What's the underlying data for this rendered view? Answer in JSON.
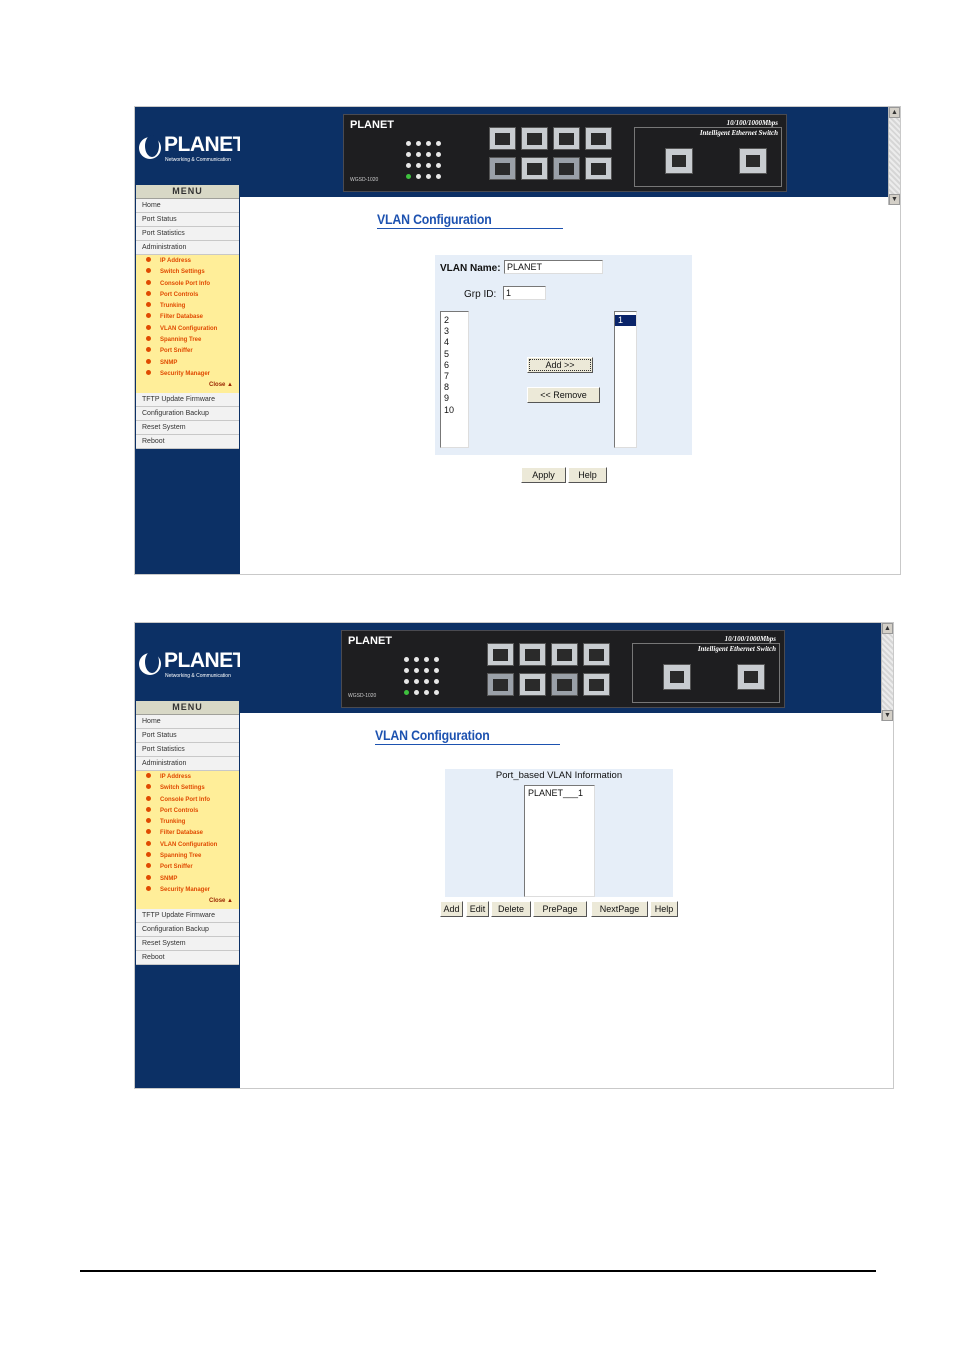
{
  "brand": {
    "logo_text": "PLANET",
    "logo_sub": "Networking & Communication",
    "device_brand": "PLANET",
    "device_model": "WGSD-1020",
    "device_title_line1": "10/100/1000Mbps",
    "device_title_line2": "Intelligent Ethernet Switch"
  },
  "menu": {
    "title": "MENU",
    "items_top": [
      "Home",
      "Port Status",
      "Port Statistics",
      "Administration"
    ],
    "sub_items": [
      "IP Address",
      "Switch Settings",
      "Console Port Info",
      "Port Controls",
      "Trunking",
      "Filter Database",
      "VLAN Configuration",
      "Spanning Tree",
      "Port Sniffer",
      "SNMP",
      "Security Manager"
    ],
    "close_label": "Close",
    "items_bottom": [
      "TFTP Update Firmware",
      "Configuration Backup",
      "Reset System",
      "Reboot"
    ]
  },
  "screen1": {
    "title": "VLAN Configuration",
    "vlan_name_label": "VLAN Name:",
    "vlan_name_value": "PLANET",
    "grp_id_label": "Grp ID:",
    "grp_id_value": "1",
    "available_ports": [
      "2",
      "3",
      "4",
      "5",
      "6",
      "7",
      "8",
      "9",
      "10"
    ],
    "member_ports": [
      "1"
    ],
    "add_button": "Add   >>",
    "remove_button": "<< Remove",
    "apply_button": "Apply",
    "help_button": "Help"
  },
  "screen2": {
    "title": "VLAN Configuration",
    "info_title": "Port_based VLAN Information",
    "vlan_list": [
      "PLANET___1"
    ],
    "buttons": {
      "add": "Add",
      "edit": "Edit",
      "delete": "Delete",
      "prepage": "PrePage",
      "nextpage": "NextPage",
      "help": "Help"
    }
  },
  "colors": {
    "navy": "#0c3065",
    "menu_highlight": "#ffee99",
    "submenu_text": "#e04a00",
    "title_blue": "#1d52b0",
    "form_bg": "#e6eef8"
  }
}
